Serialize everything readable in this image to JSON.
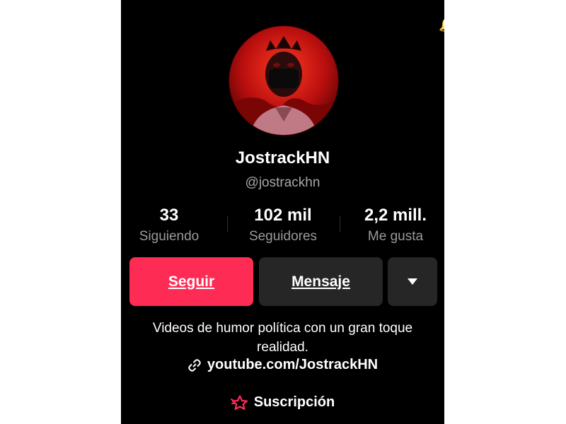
{
  "profile": {
    "display_name": "JostrackHN",
    "username": "@jostrackhn",
    "avatar_icon": "profile-avatar-image"
  },
  "stats": [
    {
      "value": "33",
      "label": "Siguiendo"
    },
    {
      "value": "102 mil",
      "label": "Seguidores"
    },
    {
      "value": "2,2 mill.",
      "label": "Me gusta"
    }
  ],
  "actions": {
    "follow_label": "Seguir",
    "message_label": "Mensaje",
    "more_icon": "triangle-down-icon"
  },
  "bio": {
    "line1": "Videos de humor política con un gran toque",
    "line2": "realidad."
  },
  "link": {
    "icon": "link-icon",
    "text": "youtube.com/JostrackHN"
  },
  "subscription": {
    "icon": "subscription-star-icon",
    "label": "Suscripción"
  },
  "colors": {
    "accent": "#fe2c55",
    "background": "#000000",
    "secondary_button": "#262626",
    "muted_text": "#9a9a9a"
  }
}
